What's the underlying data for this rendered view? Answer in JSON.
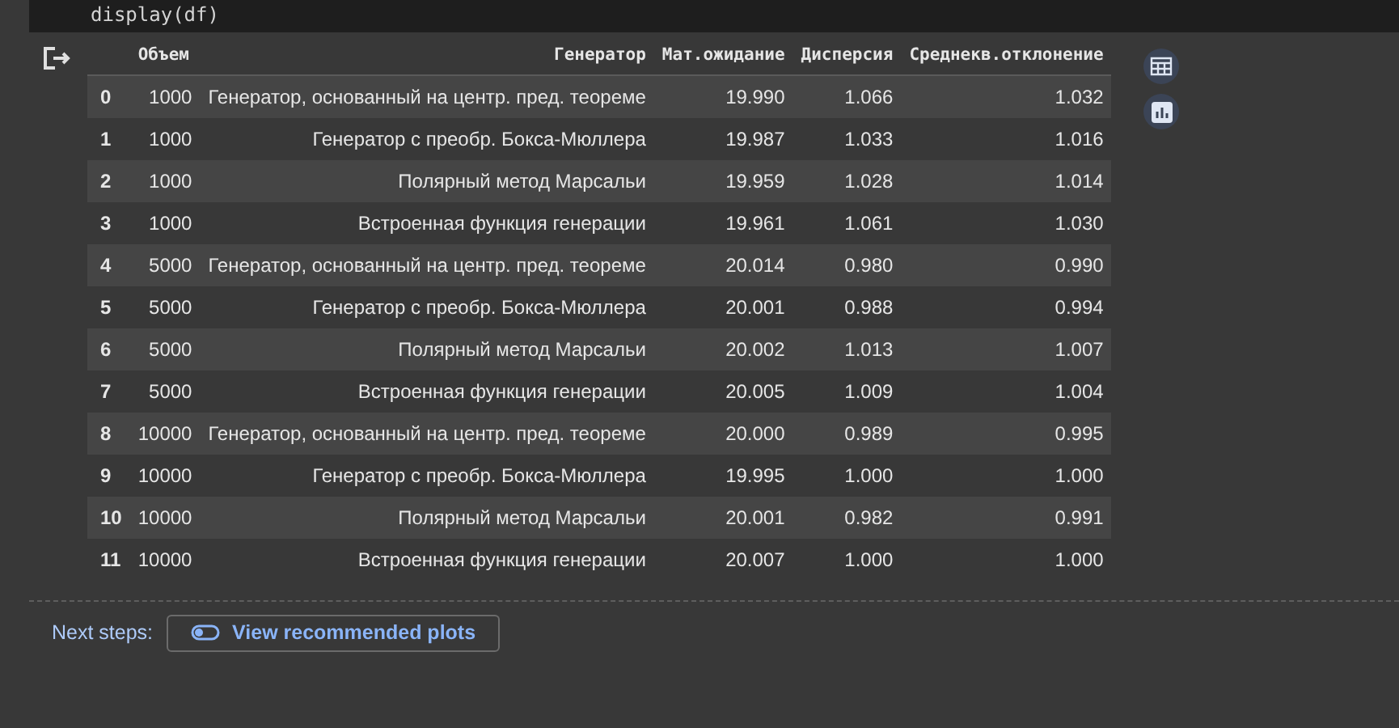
{
  "code": "display(df)",
  "table": {
    "columns": [
      "",
      "Объем",
      "Генератор",
      "Мат.ожидание",
      "Дисперсия",
      "Среднекв.отклонение"
    ],
    "rows": [
      [
        "0",
        "1000",
        "Генератор, основанный на центр. пред. теореме",
        "19.990",
        "1.066",
        "1.032"
      ],
      [
        "1",
        "1000",
        "Генератор с преобр. Бокса-Мюллера",
        "19.987",
        "1.033",
        "1.016"
      ],
      [
        "2",
        "1000",
        "Полярный метод Марсальи",
        "19.959",
        "1.028",
        "1.014"
      ],
      [
        "3",
        "1000",
        "Встроенная функция генерации",
        "19.961",
        "1.061",
        "1.030"
      ],
      [
        "4",
        "5000",
        "Генератор, основанный на центр. пред. теореме",
        "20.014",
        "0.980",
        "0.990"
      ],
      [
        "5",
        "5000",
        "Генератор с преобр. Бокса-Мюллера",
        "20.001",
        "0.988",
        "0.994"
      ],
      [
        "6",
        "5000",
        "Полярный метод Марсальи",
        "20.002",
        "1.013",
        "1.007"
      ],
      [
        "7",
        "5000",
        "Встроенная функция генерации",
        "20.005",
        "1.009",
        "1.004"
      ],
      [
        "8",
        "10000",
        "Генератор, основанный на центр. пред. теореме",
        "20.000",
        "0.989",
        "0.995"
      ],
      [
        "9",
        "10000",
        "Генератор с преобр. Бокса-Мюллера",
        "19.995",
        "1.000",
        "1.000"
      ],
      [
        "10",
        "10000",
        "Полярный метод Марсальи",
        "20.001",
        "0.982",
        "0.991"
      ],
      [
        "11",
        "10000",
        "Встроенная функция генерации",
        "20.007",
        "1.000",
        "1.000"
      ]
    ]
  },
  "next_steps": {
    "label": "Next steps:",
    "button": "View recommended plots"
  }
}
